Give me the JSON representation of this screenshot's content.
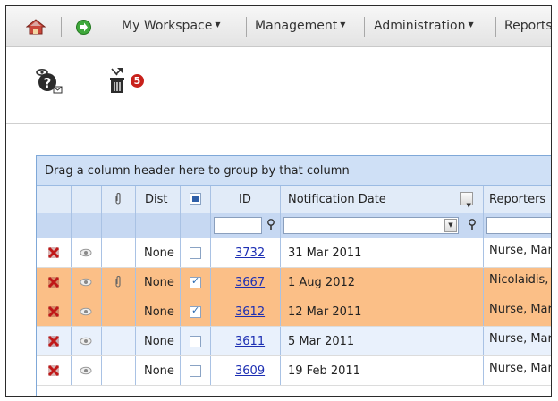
{
  "menu": {
    "items": [
      {
        "label": "My Workspace",
        "caret": "▼"
      },
      {
        "label": "Management",
        "caret": "▼"
      },
      {
        "label": "Administration",
        "caret": "▼"
      },
      {
        "label": "Reports",
        "caret": ""
      }
    ]
  },
  "toolbar": {
    "badge_count": "5"
  },
  "grid": {
    "group_hint": "Drag a column header here to group by that column",
    "headers": {
      "dist": "Dist",
      "id": "ID",
      "notification_date": "Notification Date",
      "reporters": "Reporters"
    },
    "dropdown_glyph": "▼",
    "rows": [
      {
        "dist": "None",
        "checked": false,
        "id": "3732",
        "date": "31 Mar 2011",
        "reporter": "Nurse, Mar",
        "highlight": "#ffffff",
        "attachment": false
      },
      {
        "dist": "None",
        "checked": true,
        "id": "3667",
        "date": "1 Aug 2012",
        "reporter": "Nicolaidis,",
        "highlight": "#fbbf87",
        "attachment": true
      },
      {
        "dist": "None",
        "checked": true,
        "id": "3612",
        "date": "12 Mar 2011",
        "reporter": "Nurse, Mar",
        "highlight": "#fbbf87",
        "attachment": false
      },
      {
        "dist": "None",
        "checked": false,
        "id": "3611",
        "date": "5 Mar 2011",
        "reporter": "Nurse, Mar",
        "highlight": "#e9f1fc",
        "attachment": false
      },
      {
        "dist": "None",
        "checked": false,
        "id": "3609",
        "date": "19 Feb 2011",
        "reporter": "Nurse, Mar",
        "highlight": "#ffffff",
        "attachment": false
      }
    ]
  },
  "colors": {
    "highlight_row": "#fbbf87",
    "alt_row": "#e9f1fc",
    "link": "#1d2fb3",
    "badge": "#c8211b"
  }
}
